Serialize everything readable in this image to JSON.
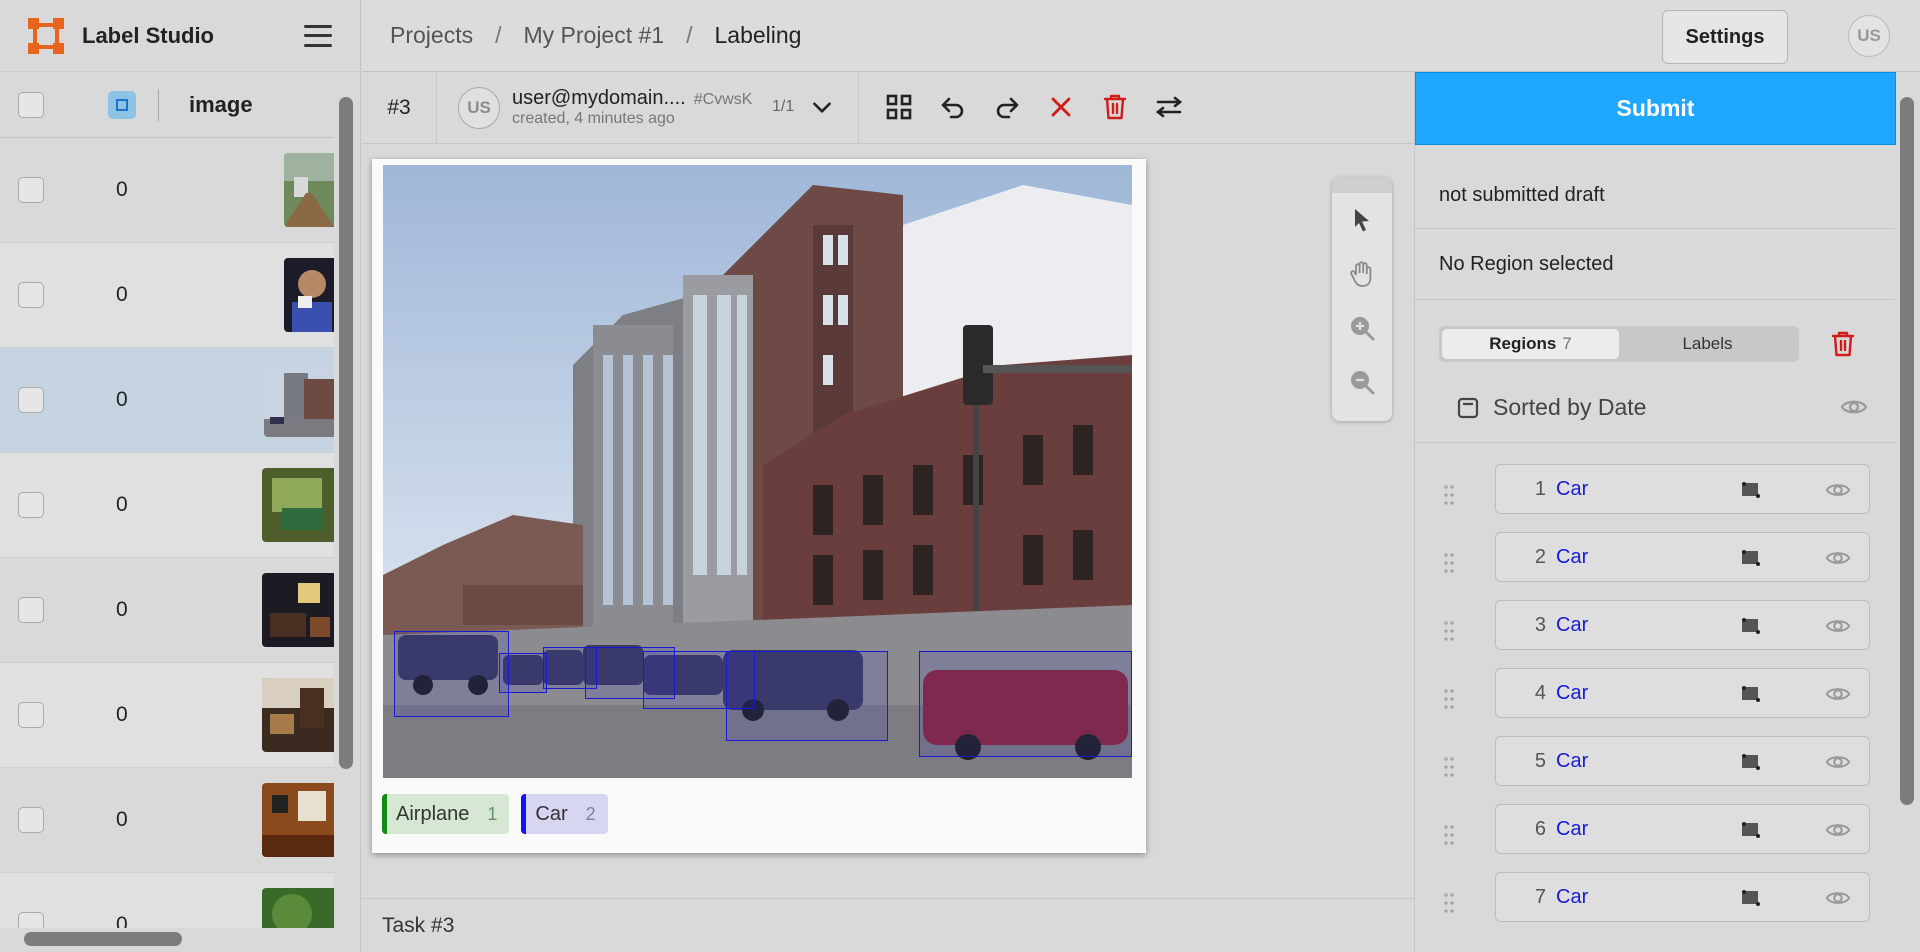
{
  "app": {
    "name": "Label Studio"
  },
  "breadcrumb": {
    "projects": "Projects",
    "project": "My Project #1",
    "current": "Labeling",
    "sep": "/"
  },
  "header": {
    "settings_label": "Settings",
    "user_initials": "US"
  },
  "data_manager": {
    "columns": {
      "image": "image"
    },
    "rows": [
      {
        "count": "0"
      },
      {
        "count": "0"
      },
      {
        "count": "0",
        "selected": true
      },
      {
        "count": "0"
      },
      {
        "count": "0"
      },
      {
        "count": "0"
      },
      {
        "count": "0"
      },
      {
        "count": "0"
      }
    ]
  },
  "annotation": {
    "task_id": "#3",
    "user_initials": "US",
    "user_email": "user@mydomain....",
    "hash": "#CvwsK",
    "created": "created, 4 minutes ago",
    "counter": "1/1"
  },
  "toolbar_icons": [
    "grid-icon",
    "undo-icon",
    "redo-icon",
    "reset-icon",
    "delete-icon",
    "settings-toggle-icon"
  ],
  "zoom_tools": [
    "pointer-icon",
    "hand-icon",
    "zoom-in-icon",
    "zoom-out-icon"
  ],
  "labels": [
    {
      "name": "Airplane",
      "hotkey": "1",
      "color": "#138a13"
    },
    {
      "name": "Car",
      "hotkey": "2",
      "color": "#1212ff"
    }
  ],
  "footer": {
    "task": "Task #3"
  },
  "right_panel": {
    "submit_label": "Submit",
    "draft_status": "not submitted draft",
    "selection_status": "No Region selected",
    "tabs": {
      "regions": "Regions",
      "regions_count": "7",
      "labels": "Labels"
    },
    "sort_label": "Sorted by Date",
    "regions": [
      {
        "num": "1",
        "label": "Car"
      },
      {
        "num": "2",
        "label": "Car"
      },
      {
        "num": "3",
        "label": "Car"
      },
      {
        "num": "4",
        "label": "Car"
      },
      {
        "num": "5",
        "label": "Car"
      },
      {
        "num": "6",
        "label": "Car"
      },
      {
        "num": "7",
        "label": "Car"
      }
    ]
  },
  "colors": {
    "accent": "#1ea7fd",
    "region_label": "#1a1ad6",
    "brand": "#e8641b",
    "delete": "#d11a1a"
  }
}
